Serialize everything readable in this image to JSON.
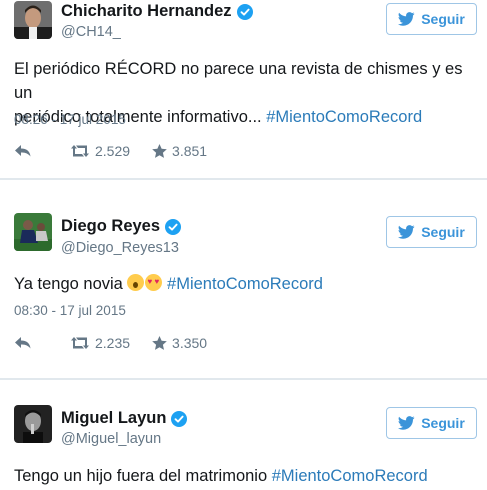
{
  "follow_label": "Seguir",
  "tweets": [
    {
      "name": "Chicharito Hernandez",
      "handle": "@CH14_",
      "text_line1": "El periódico RÉCORD no parece una revista de chismes y es un",
      "text_line2": "periódico totalmente informativo... ",
      "hashtag": "#MientoComoRecord",
      "time": "08:26 - 17 jul 2015",
      "retweets": "2.529",
      "likes": "3.851"
    },
    {
      "name": "Diego Reyes",
      "handle": "@Diego_Reyes13",
      "text": "Ya tengo novia ",
      "emojis": [
        "face-screaming-emoji",
        "heart-eyes-emoji"
      ],
      "hashtag": "#MientoComoRecord",
      "time": "08:30 - 17 jul 2015",
      "retweets": "2.235",
      "likes": "3.350"
    },
    {
      "name": "Miguel Layun",
      "handle": "@Miguel_layun",
      "text": "Tengo un hijo fuera del matrimonio ",
      "hashtag": "#MientoComoRecord"
    }
  ],
  "colors": {
    "link": "#2b7bb9",
    "follow": "#3b94d9",
    "verified": "#1da1f2",
    "muted": "#657786"
  },
  "icons": [
    "verified-badge-icon",
    "twitter-bird-icon",
    "reply-icon",
    "retweet-icon",
    "star-icon"
  ]
}
